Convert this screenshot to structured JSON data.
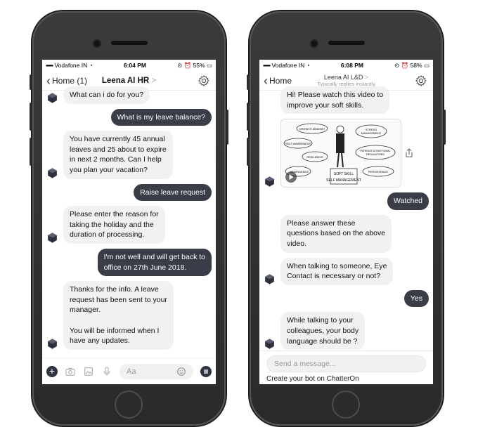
{
  "left_phone": {
    "status": {
      "carrier": "Vodafone IN",
      "time": "6:04 PM",
      "battery": "55%"
    },
    "nav": {
      "back_label": "Home (1)",
      "title": "Leena AI HR",
      "title_suffix": ">"
    },
    "messages": [
      {
        "dir": "in",
        "text": "What can i do for you?",
        "avatar": true
      },
      {
        "dir": "out",
        "text": "What is my leave balance?"
      },
      {
        "dir": "in",
        "text": "You have currently 45 annual\nleaves and 25 about to expire\nin next 2 months. Can I help\nyou  plan your vacation?",
        "avatar": true
      },
      {
        "dir": "out",
        "text": "Raise leave request"
      },
      {
        "dir": "in",
        "text": "Please enter the reason for\ntaking the holiday and the\nduration of processing.",
        "avatar": true
      },
      {
        "dir": "out",
        "text": "I'm not well and will get back to\noffice on 27th June 2018."
      },
      {
        "dir": "in",
        "text": "Thanks for the info.  A leave\nrequest has been sent to your\nmanager.\n\nYou will be informed when I\nhave any updates.",
        "avatar": true
      }
    ],
    "composer": {
      "placeholder": "Aa"
    }
  },
  "right_phone": {
    "status": {
      "carrier": "Vodafone IN",
      "time": "6:08 PM",
      "battery": "58%"
    },
    "nav": {
      "back_label": "Home",
      "title": "Leena AI L&D",
      "title_suffix": ">",
      "subtitle": "Typically replies instantly"
    },
    "messages": [
      {
        "dir": "in",
        "text": "Hi! Please watch this video to\nimprove your soft skills."
      },
      {
        "dir": "video"
      },
      {
        "dir": "out",
        "text": "Watched"
      },
      {
        "dir": "in",
        "text": "Please answer these\nquestions based on the above\nvideo."
      },
      {
        "dir": "in",
        "text": "When talking to someone, Eye\nContact is necessary or not?",
        "avatar": true
      },
      {
        "dir": "out",
        "text": "Yes"
      },
      {
        "dir": "in",
        "text": "While talking to your\ncolleagues, your body\nlanguage should be ?",
        "avatar": true
      }
    ],
    "video": {
      "labels": [
        "GROWTH MINDSET",
        "STRESS\nMANAGEMENT",
        "SELF AWARENESS",
        "PATIENCE & EMOTIONAL\nREGULATIONS",
        "RESILIENCE",
        "CONFIDENCE",
        "PERSISTENCE"
      ],
      "caption_line1": "SOFT SKILL",
      "caption_line2": "SELF MANAGEMENT"
    },
    "composer": {
      "placeholder": "Send a message...",
      "footer": "Create your bot on ChatterOn"
    }
  }
}
